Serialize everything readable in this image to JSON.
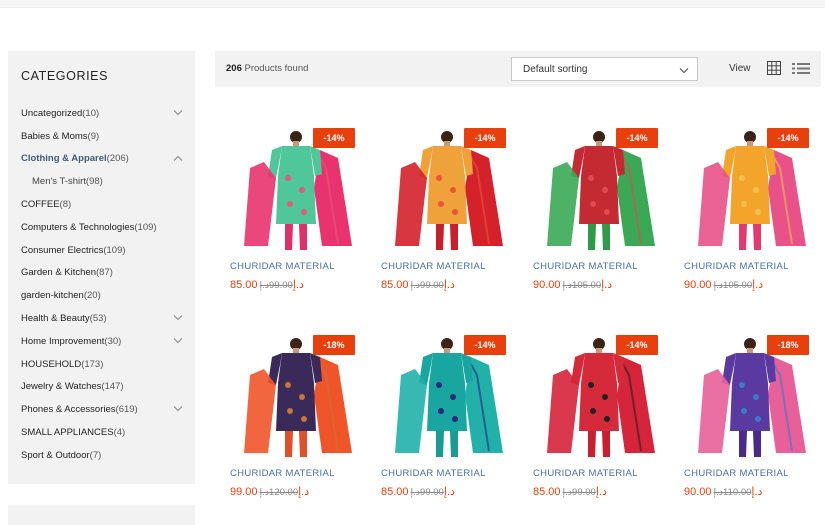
{
  "sidebar": {
    "title": "CATEGORIES",
    "items": [
      {
        "name": "Uncategorized",
        "count": "(10)",
        "expand": "down"
      },
      {
        "name": "Babies & Moms",
        "count": "(9)"
      },
      {
        "name": "Clothing & Apparel",
        "count": "(206)",
        "expand": "up",
        "active": true
      },
      {
        "name": "Men's T-shirt",
        "count": "(98)",
        "sub": true
      },
      {
        "name": "COFFEE",
        "count": "(8)"
      },
      {
        "name": "Computers & Technologies",
        "count": "(109)"
      },
      {
        "name": "Consumer Electrics",
        "count": "(109)"
      },
      {
        "name": "Garden & Kitchen",
        "count": "(87)"
      },
      {
        "name": "garden-kitchen",
        "count": "(20)"
      },
      {
        "name": "Health & Beauty",
        "count": "(53)",
        "expand": "down"
      },
      {
        "name": "Home Improvement",
        "count": "(30)",
        "expand": "down"
      },
      {
        "name": "HOUSEHOLD",
        "count": "(173)"
      },
      {
        "name": "Jewelry & Watches",
        "count": "(147)"
      },
      {
        "name": "Phones & Accessories",
        "count": "(619)",
        "expand": "down"
      },
      {
        "name": "SMALL APPLIANCES",
        "count": "(4)"
      },
      {
        "name": "Sport & Outdoor",
        "count": "(7)"
      }
    ]
  },
  "toolbar": {
    "count": "206",
    "found_label": "Products found",
    "sorting": "Default sorting",
    "view_label": "View"
  },
  "products": [
    {
      "name": "CHURIDAR MATERIAL",
      "badge": "-14%",
      "price": "85.00",
      "old_price": "99.00",
      "currency": "د.إ",
      "colors": {
        "top": "#4fc79a",
        "bottom": "#e0306a",
        "dupatta": "#e8336e",
        "accent": "#e25a7c"
      }
    },
    {
      "name": "CHURIDAR MATERIAL",
      "badge": "-14%",
      "price": "85.00",
      "old_price": "99.00",
      "currency": "د.إ",
      "colors": {
        "top": "#f0a23a",
        "bottom": "#c8202a",
        "dupatta": "#d4212a",
        "accent": "#e8553a"
      }
    },
    {
      "name": "CHURIDAR MATERIAL",
      "badge": "-14%",
      "price": "90.00",
      "old_price": "105.00",
      "currency": "د.إ",
      "colors": {
        "top": "#c42a32",
        "bottom": "#2f9a4a",
        "dupatta": "#3aa855",
        "accent": "#e04a52"
      }
    },
    {
      "name": "CHURIDAR MATERIAL",
      "badge": "-14%",
      "price": "90.00",
      "old_price": "105.00",
      "currency": "د.إ",
      "colors": {
        "top": "#f2a52a",
        "bottom": "#e23a70",
        "dupatta": "#e85288",
        "accent": "#f0c050"
      }
    },
    {
      "name": "CHURIDAR MATERIAL",
      "badge": "-18%",
      "price": "99.00",
      "old_price": "120.00",
      "currency": "د.إ",
      "colors": {
        "top": "#3a2a5a",
        "bottom": "#e0502a",
        "dupatta": "#f0552a",
        "accent": "#c8743a"
      }
    },
    {
      "name": "CHURIDAR MATERIAL",
      "badge": "-14%",
      "price": "85.00",
      "old_price": "99.00",
      "currency": "د.إ",
      "colors": {
        "top": "#1aa6a0",
        "bottom": "#1a9c96",
        "dupatta": "#22b0aa",
        "accent": "#2a2a7a"
      }
    },
    {
      "name": "CHURIDAR MATERIAL",
      "badge": "-14%",
      "price": "85.00",
      "old_price": "99.00",
      "currency": "د.إ",
      "colors": {
        "top": "#d42a3a",
        "bottom": "#c81e30",
        "dupatta": "#d6243a",
        "accent": "#222222"
      }
    },
    {
      "name": "CHURIDAR MATERIAL",
      "badge": "-18%",
      "price": "90.00",
      "old_price": "110.00",
      "currency": "د.إ",
      "colors": {
        "top": "#5a3aa0",
        "bottom": "#4a2a8a",
        "dupatta": "#e8609a",
        "accent": "#3a7ac8"
      }
    }
  ]
}
